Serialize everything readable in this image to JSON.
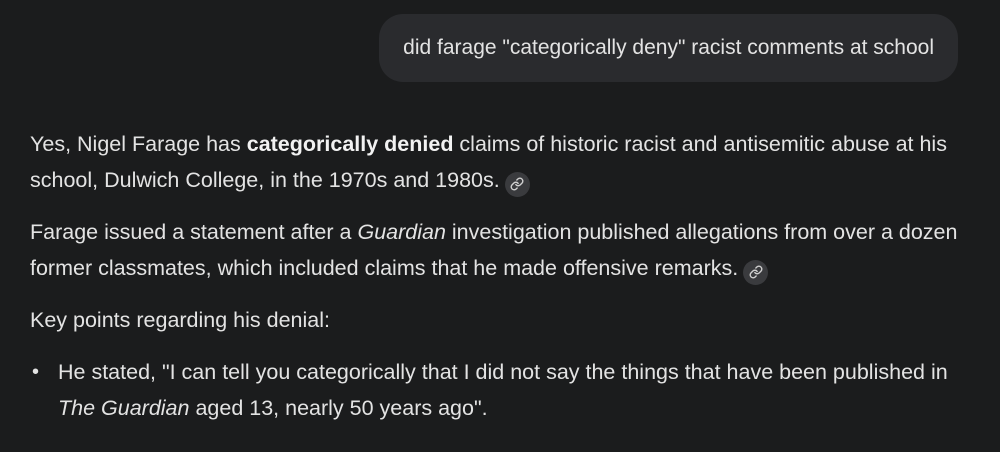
{
  "user_query": "did farage \"categorically deny\" racist comments at school",
  "response": {
    "p1": {
      "before_bold": "Yes, Nigel Farage has ",
      "bold": "categorically denied",
      "after_bold": " claims of historic racist and antisemitic abuse at his school, Dulwich College, in the 1970s and 1980s."
    },
    "p2": {
      "before_italic": "Farage issued a statement after a ",
      "italic": "Guardian",
      "after_italic": " investigation published allegations from over a dozen former classmates, which included claims that he made offensive remarks."
    },
    "p3": "Key points regarding his denial:",
    "bullet_1": {
      "bullet_glyph": "•",
      "before_italic": "He stated, \"I can tell you categorically that I did not say the things that have been published in ",
      "italic": "The Guardian",
      "after_italic": " aged 13, nearly 50 years ago\"."
    }
  },
  "icons": {
    "source_link": "link-icon"
  },
  "colors": {
    "background": "#1b1c1d",
    "bubble": "#2a2b2e",
    "text": "#e3e3e3",
    "chip": "#3a3b3e"
  }
}
